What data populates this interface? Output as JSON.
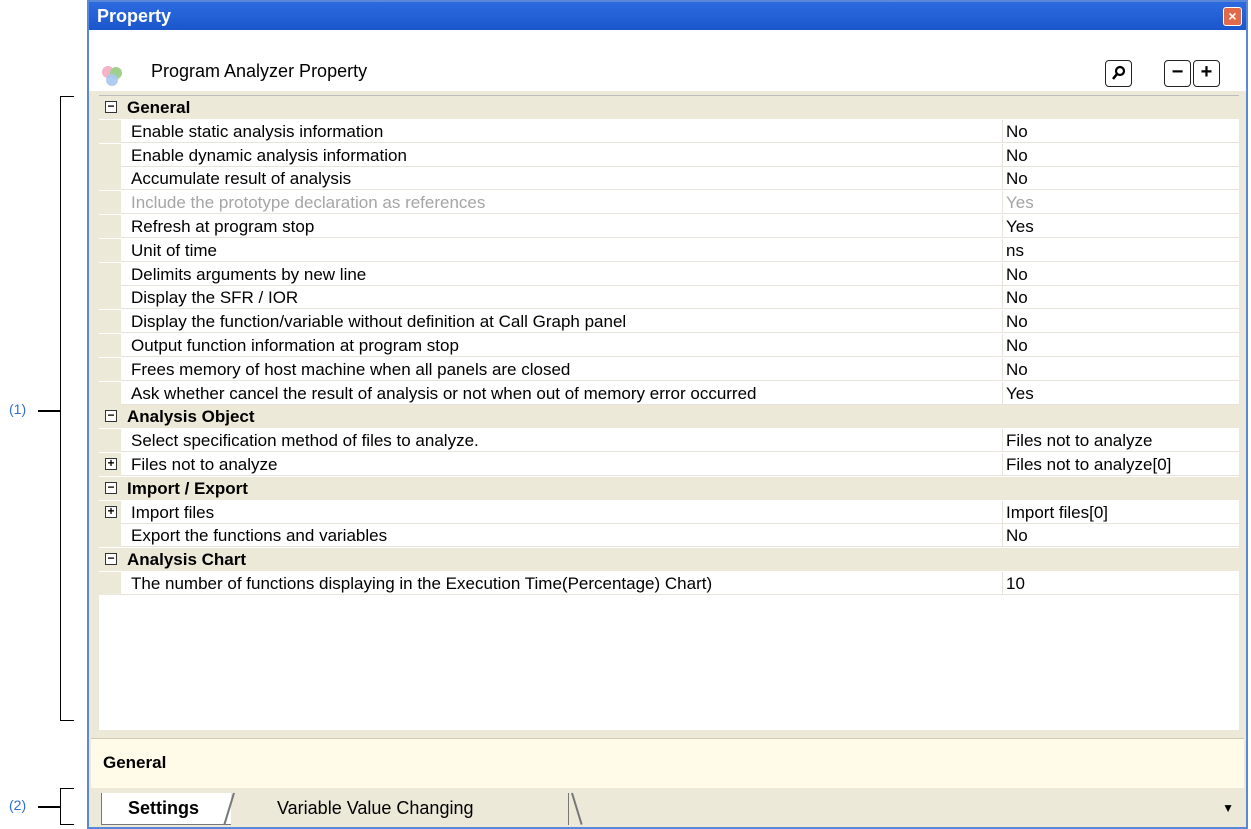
{
  "callouts": {
    "grid": "(1)",
    "tabs": "(2)"
  },
  "window": {
    "title": "Property",
    "close_icon": "close-icon"
  },
  "toolbar": {
    "caption": "Program Analyzer Property",
    "search_label": "",
    "collapse_label": "−",
    "expand_label": "+"
  },
  "grid": {
    "rows": [
      {
        "kind": "category",
        "toggle": "⊟",
        "name": "General"
      },
      {
        "kind": "prop",
        "name": "Enable static analysis information",
        "value": "No"
      },
      {
        "kind": "prop",
        "name": "Enable dynamic analysis information",
        "value": "No"
      },
      {
        "kind": "prop",
        "name": "Accumulate result of analysis",
        "value": "No"
      },
      {
        "kind": "prop",
        "disabled": true,
        "name": "Include the prototype declaration as references",
        "value": "Yes"
      },
      {
        "kind": "prop",
        "name": "Refresh at program stop",
        "value": "Yes"
      },
      {
        "kind": "prop",
        "name": "Unit of time",
        "value": "ns"
      },
      {
        "kind": "prop",
        "name": "Delimits arguments by new line",
        "value": "No"
      },
      {
        "kind": "prop",
        "name": "Display the SFR / IOR",
        "value": "No"
      },
      {
        "kind": "prop",
        "name": "Display the function/variable without definition at Call Graph panel",
        "value": "No"
      },
      {
        "kind": "prop",
        "name": "Output function information at program stop",
        "value": "No"
      },
      {
        "kind": "prop",
        "name": "Frees memory of host machine when all panels are closed",
        "value": "No"
      },
      {
        "kind": "prop",
        "name": "Ask whether cancel the result of analysis or not when out of memory error occurred",
        "value": "Yes"
      },
      {
        "kind": "category",
        "toggle": "⊟",
        "name": "Analysis Object"
      },
      {
        "kind": "prop",
        "name": "Select specification method of files to analyze.",
        "value": "Files not to analyze"
      },
      {
        "kind": "prop",
        "toggle": "⊞",
        "name": "Files not to analyze",
        "value": "Files not to analyze[0]"
      },
      {
        "kind": "category",
        "toggle": "⊟",
        "name": "Import / Export"
      },
      {
        "kind": "prop",
        "toggle": "⊞",
        "name": "Import files",
        "value": "Import files[0]"
      },
      {
        "kind": "prop",
        "name": "Export the functions and variables",
        "value": "No"
      },
      {
        "kind": "category",
        "toggle": "⊟",
        "name": "Analysis Chart"
      },
      {
        "kind": "prop",
        "name": "The number of functions displaying in the Execution Time(Percentage) Chart)",
        "value": "10"
      }
    ]
  },
  "description": {
    "title": "General"
  },
  "tabs": [
    {
      "label": "Settings",
      "active": true
    },
    {
      "label": "Variable Value Changing",
      "active": false
    }
  ],
  "colors": {
    "titlebar": "#1b56cc",
    "callout": "#2f6fd1",
    "disabled": "#a5a5a5"
  }
}
